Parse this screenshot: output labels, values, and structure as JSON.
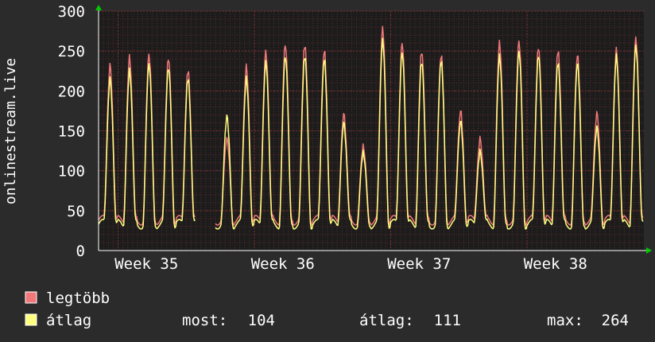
{
  "chart_data": {
    "type": "line",
    "ylabel": "onlinestream.live",
    "ylim": [
      0,
      300
    ],
    "y_ticks": [
      "0",
      "50",
      "100",
      "150",
      "200",
      "250",
      "300"
    ],
    "x_ticks": [
      "Week 35",
      "Week 36",
      "Week 37",
      "Week 38"
    ],
    "grid": true,
    "legend_placement": "bottom-left",
    "series": [
      {
        "name": "legtöbb",
        "color": "#f07878",
        "daily_peaks": [
          232,
          242,
          245,
          241,
          226,
          0,
          140,
          230,
          249,
          258,
          258,
          251,
          171,
          130,
          278,
          260,
          250,
          245,
          175,
          140,
          260,
          262,
          255,
          251,
          245,
          172,
          251,
          266
        ]
      },
      {
        "name": "átlag",
        "color": "#ffff80",
        "daily_peaks": [
          215,
          225,
          233,
          229,
          216,
          0,
          168,
          215,
          236,
          243,
          244,
          240,
          160,
          122,
          263,
          248,
          237,
          238,
          162,
          124,
          243,
          249,
          245,
          236,
          235,
          154,
          243,
          256
        ]
      }
    ],
    "stats": {
      "most_label": "most:",
      "most_value": "104",
      "atlag_label": "átlag:",
      "atlag_value": "111",
      "max_label": "max:",
      "max_value": "264"
    }
  },
  "colors": {
    "background": "#2b2b2b",
    "plot_background": "#1c1c1c",
    "grid": "#5a2a2a",
    "text": "#ffffff",
    "axis_arrow": "#00cc00"
  }
}
